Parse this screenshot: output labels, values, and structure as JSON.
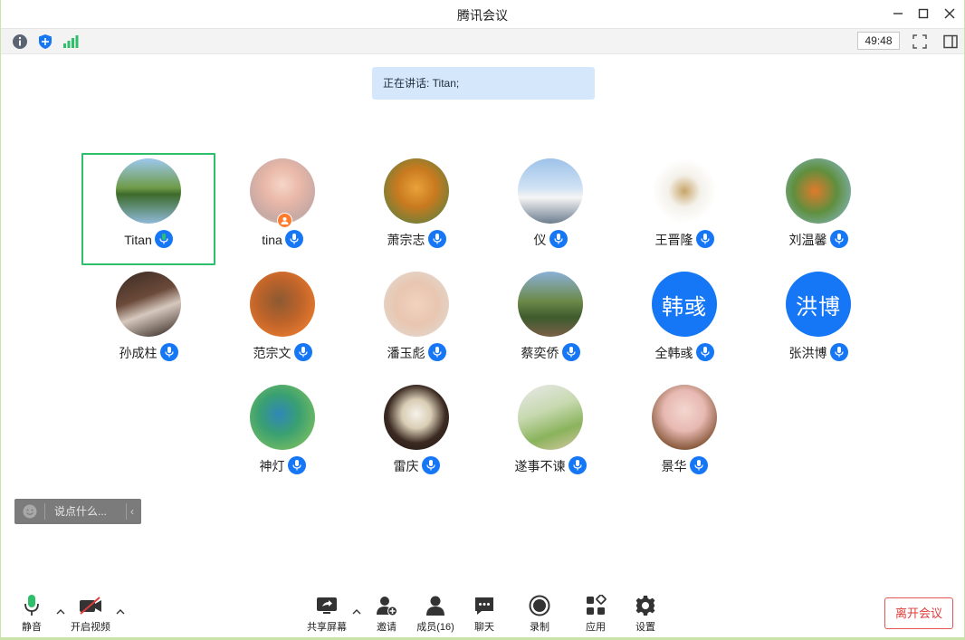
{
  "window": {
    "title": "腾讯会议",
    "controls": {
      "minimize": "minimize",
      "maximize": "maximize",
      "close": "close"
    }
  },
  "statusbar": {
    "icons": [
      "info-icon",
      "shield-icon",
      "signal-icon"
    ],
    "timer": "49:48",
    "right_icons": [
      "fullscreen-icon",
      "sidebar-layout-icon"
    ]
  },
  "speaking": "正在讲话: Titan;",
  "participants": [
    {
      "name": "Titan",
      "avatar": "photo-tree-lake",
      "active": true,
      "host": false
    },
    {
      "name": "tina",
      "avatar": "photo-girl",
      "active": false,
      "host": true
    },
    {
      "name": "萧宗志",
      "avatar": "photo-monkey",
      "active": false,
      "host": false
    },
    {
      "name": "仪",
      "avatar": "photo-wedding",
      "active": false,
      "host": false
    },
    {
      "name": "王晋隆",
      "avatar": "photo-devices",
      "active": false,
      "host": false
    },
    {
      "name": "刘温馨",
      "avatar": "photo-orange-tree",
      "active": false,
      "host": false
    },
    {
      "name": "孙成柱",
      "avatar": "photo-stage",
      "active": false,
      "host": false
    },
    {
      "name": "范宗文",
      "avatar": "photo-meerkat",
      "active": false,
      "host": false
    },
    {
      "name": "潘玉彪",
      "avatar": "photo-baby",
      "active": false,
      "host": false
    },
    {
      "name": "蔡奕侨",
      "avatar": "photo-family",
      "active": false,
      "host": false
    },
    {
      "name": "全韩彧",
      "avatar_text": "韩彧",
      "active": false,
      "host": false
    },
    {
      "name": "张洪博",
      "avatar_text": "洪博",
      "active": false,
      "host": false
    },
    {
      "name": "神灯",
      "avatar": "photo-kingfisher",
      "active": false,
      "host": false
    },
    {
      "name": "雷庆",
      "avatar": "photo-panda",
      "active": false,
      "host": false
    },
    {
      "name": "遂事不谏",
      "avatar": "photo-child-swing",
      "active": false,
      "host": false
    },
    {
      "name": "景华",
      "avatar": "photo-baby-basket",
      "active": false,
      "host": false
    }
  ],
  "chat": {
    "placeholder": "说点什么..."
  },
  "toolbar": {
    "mute": "静音",
    "video": "开启视频",
    "share": "共享屏幕",
    "invite": "邀请",
    "members": "成员(16)",
    "chat": "聊天",
    "record": "录制",
    "apps": "应用",
    "settings": "设置",
    "leave": "离开会议"
  },
  "colors": {
    "accent": "#1677f6",
    "active_border": "#2dbf6a",
    "leave": "#e03b3b",
    "banner": "#d5e7fb"
  }
}
